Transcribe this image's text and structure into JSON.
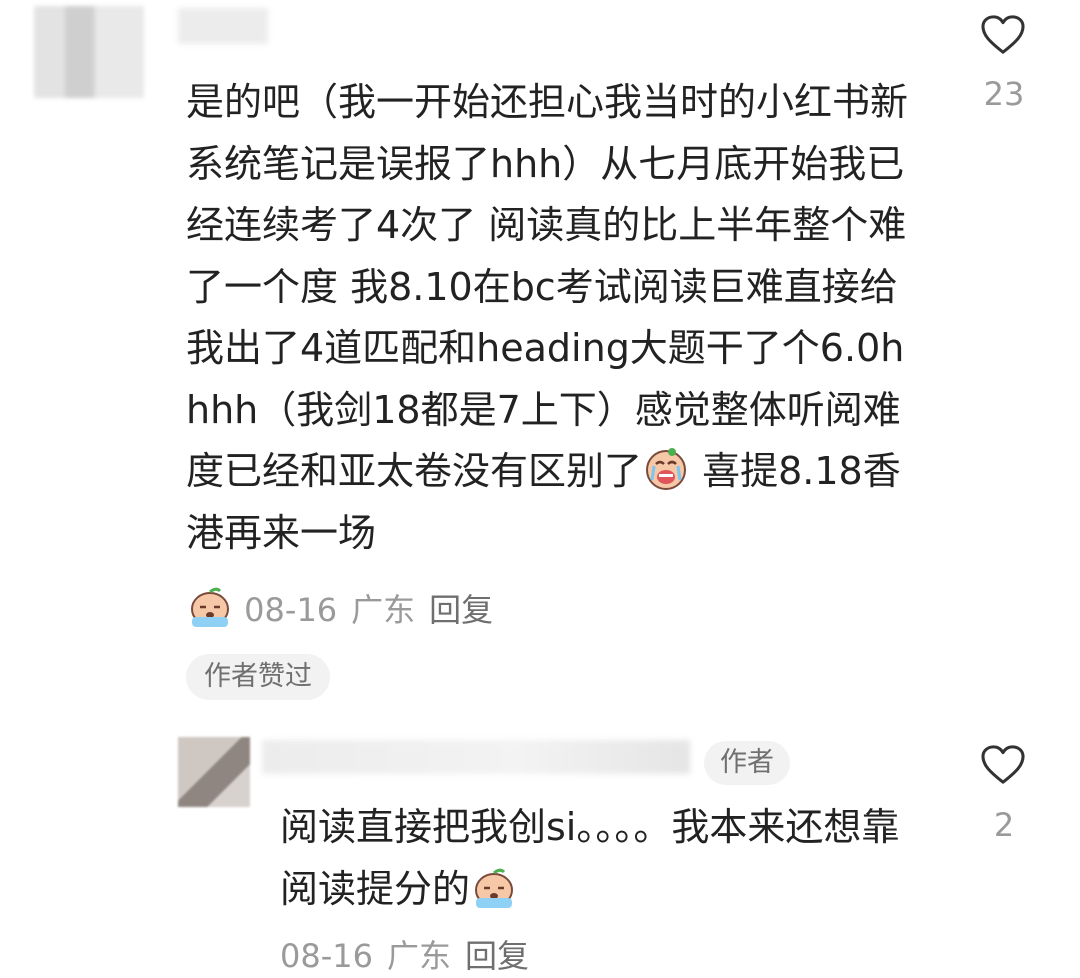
{
  "comment": {
    "text_before_emoji": "是的吧（我一开始还担心我当时的小红书新系统笔记是误报了hhh）从七月底开始我已经连续考了4次了 阅读真的比上半年整个难了一个度 我8.10在bc考试阅读巨难直接给我出了4道匹配和heading大题干了个6.0hhhh（我剑18都是7上下）感觉整体听阅难度已经和亚太卷没有区别了",
    "text_after_emoji": " 喜提8.18香港再来一场",
    "emoji_inline": "crying-face-emoji",
    "meta_emoji": "crying-peach-emoji",
    "date": "08-16",
    "location": "广东",
    "reply_label": "回复",
    "like_count": "23",
    "author_liked_badge": "作者赞过"
  },
  "reply": {
    "author_tag": "作者",
    "text": "阅读直接把我创si。。。。我本来还想靠阅读提分的",
    "emoji": "crying-peach-emoji",
    "date": "08-16",
    "location": "广东",
    "reply_label": "回复",
    "like_count": "2"
  },
  "colors": {
    "text": "#222222",
    "meta": "#9a9a9a",
    "badge_bg": "#f2f2f2"
  }
}
